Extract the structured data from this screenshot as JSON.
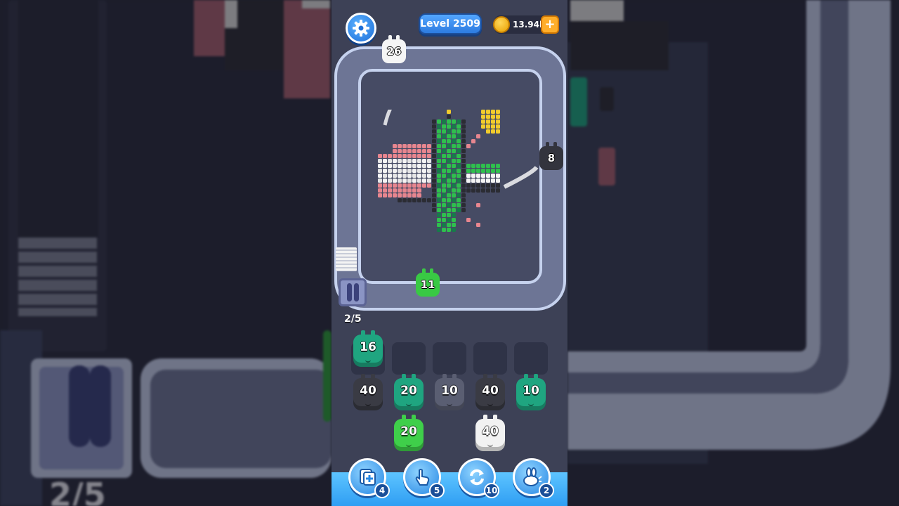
{
  "hud": {
    "level_label": "Level 2509",
    "coins": "13.94k",
    "plus": "+"
  },
  "track": {
    "top_runner_count": "26",
    "right_runner_count": "8",
    "bottom_runner_count": "11"
  },
  "progress_label": "2/5",
  "slots": {
    "top_row": [
      {
        "count": "16",
        "color": "#1fa580"
      },
      {
        "count": "",
        "color": ""
      },
      {
        "count": "",
        "color": ""
      },
      {
        "count": "",
        "color": ""
      },
      {
        "count": "",
        "color": ""
      }
    ]
  },
  "queue": {
    "row1": [
      {
        "count": "40",
        "color": "#3a3b44"
      },
      {
        "count": "20",
        "color": "#1fa580"
      },
      {
        "count": "10",
        "color": "#5a5e72"
      },
      {
        "count": "40",
        "color": "#3a3b44"
      },
      {
        "count": "10",
        "color": "#1fa580"
      }
    ],
    "row2": [
      {
        "count": "20",
        "color": "#3fcf4a"
      },
      {
        "count": "40",
        "color": "#f2f2f2"
      }
    ]
  },
  "powerups": [
    {
      "name": "add-slot",
      "count": "4"
    },
    {
      "name": "tap",
      "count": "5"
    },
    {
      "name": "shuffle",
      "count": "10"
    },
    {
      "name": "rabbit",
      "count": "2"
    }
  ],
  "colors": {
    "background": "#2b2d3f",
    "panel": "#3d4156",
    "track_border": "#c6d2ee",
    "accent_blue": "#2f9ef3",
    "coin": "#ffd75a"
  },
  "icons": [
    "gear-icon",
    "coin-icon",
    "plus-icon",
    "add-slot-icon",
    "hand-tap-icon",
    "shuffle-icon",
    "rabbit-icon"
  ]
}
